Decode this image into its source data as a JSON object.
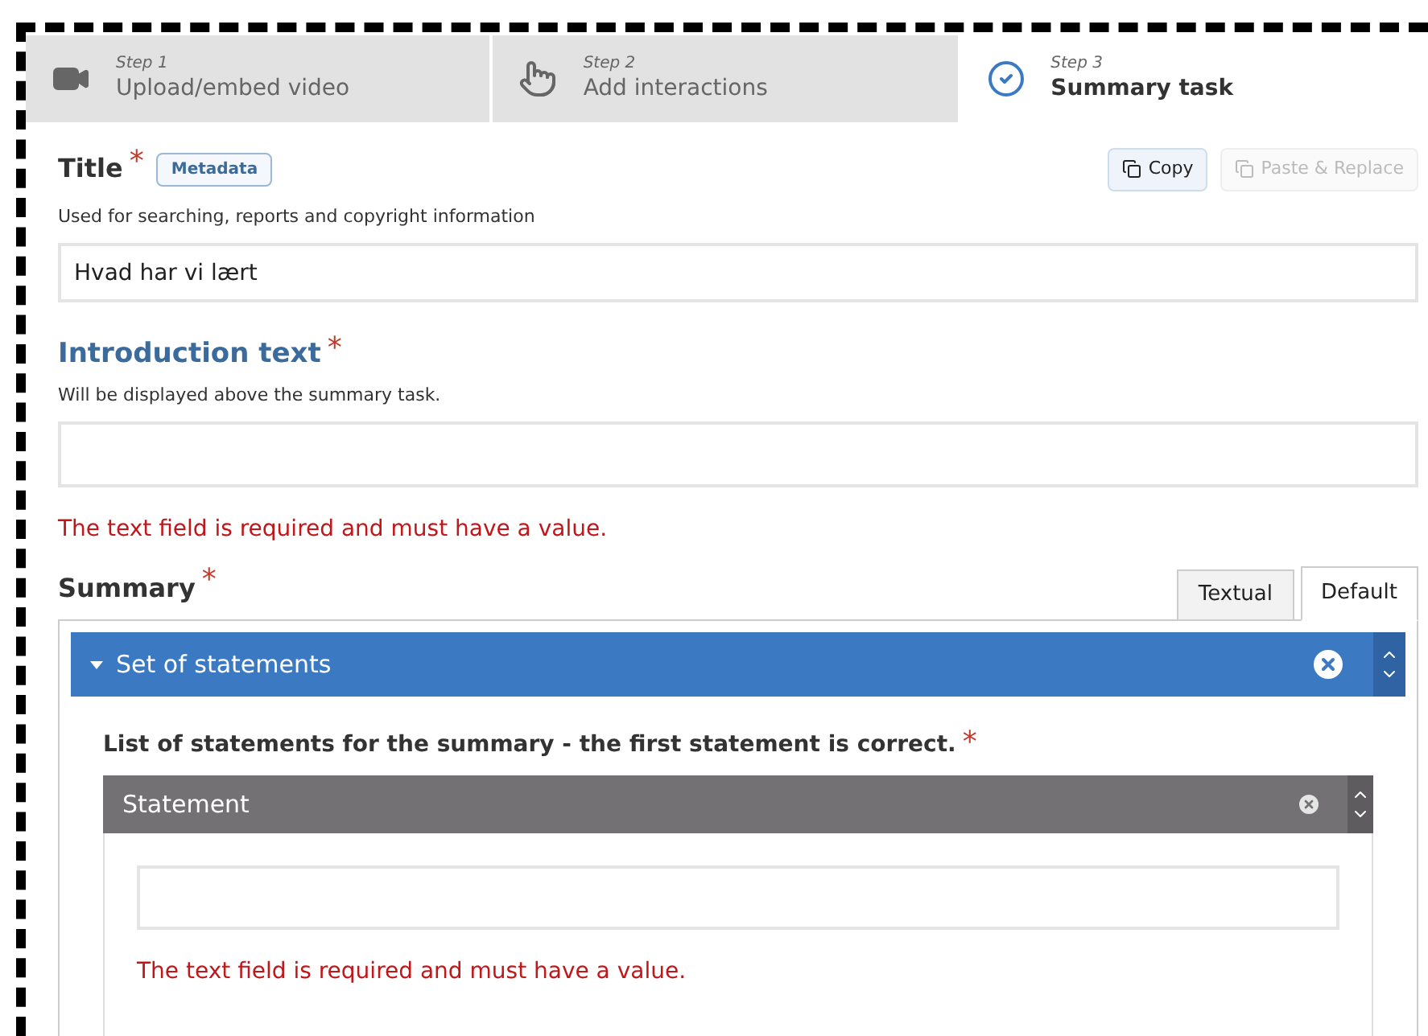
{
  "steps": [
    {
      "kind": "video",
      "step": "Step 1",
      "label": "Upload/embed video",
      "selected": false
    },
    {
      "kind": "touch",
      "step": "Step 2",
      "label": "Add interactions",
      "selected": false
    },
    {
      "kind": "check",
      "step": "Step 3",
      "label": "Summary task",
      "selected": true
    }
  ],
  "title_field": {
    "label": "Title",
    "required_mark": "*",
    "tag": "Metadata",
    "description": "Used for searching, reports and copyright information",
    "value": "Hvad har vi lært"
  },
  "actions": [
    {
      "label": "Copy",
      "disabled": false
    },
    {
      "label": "Paste & Replace",
      "disabled": true
    }
  ],
  "intro_field": {
    "label": "Introduction text",
    "required_mark": "*",
    "description": "Will be displayed above the summary task.",
    "error": "The text field is required and must have a value."
  },
  "summary": {
    "label": "Summary",
    "required_mark": "*",
    "tabs": [
      {
        "label": "Textual",
        "selected": false
      },
      {
        "label": "Default",
        "selected": true
      }
    ],
    "group": {
      "title": "Set of statements",
      "expanded": true,
      "list_label": "List of statements for the summary - the first statement is correct.",
      "required_mark": "*",
      "statement": {
        "title": "Statement",
        "error": "The text field is required and must have a value."
      }
    }
  }
}
